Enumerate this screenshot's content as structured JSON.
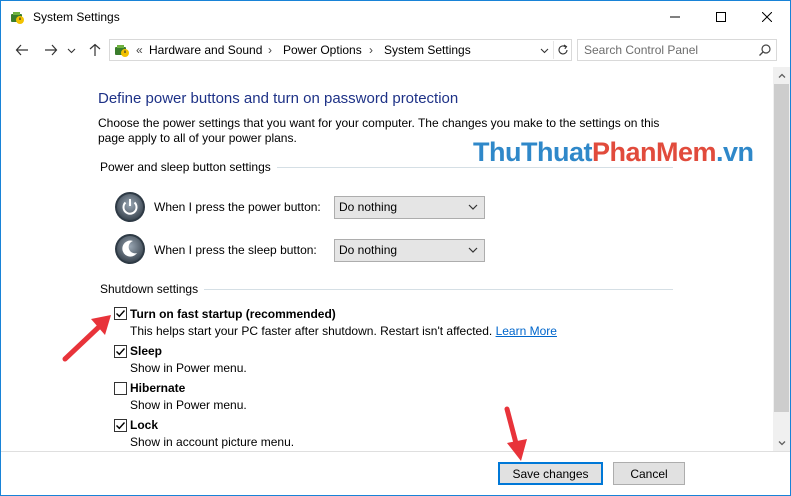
{
  "window": {
    "title": "System Settings"
  },
  "address_bar": {
    "overflow": "«",
    "crumbs": [
      "Hardware and Sound",
      "Power Options",
      "System Settings"
    ],
    "separator": "›"
  },
  "search": {
    "placeholder": "Search Control Panel"
  },
  "page": {
    "heading": "Define power buttons and turn on password protection",
    "description": "Choose the power settings that you want for your computer. The changes you make to the settings on this page apply to all of your power plans."
  },
  "power_sleep": {
    "group_label": "Power and sleep button settings",
    "power_button": {
      "label": "When I press the power button:",
      "value": "Do nothing"
    },
    "sleep_button": {
      "label": "When I press the sleep button:",
      "value": "Do nothing"
    }
  },
  "shutdown": {
    "group_label": "Shutdown settings",
    "items": [
      {
        "label": "Turn on fast startup (recommended)",
        "checked": true,
        "bold": true,
        "desc": "This helps start your PC faster after shutdown. Restart isn't affected.",
        "link": "Learn More"
      },
      {
        "label": "Sleep",
        "checked": true,
        "desc": "Show in Power menu."
      },
      {
        "label": "Hibernate",
        "checked": false,
        "desc": "Show in Power menu."
      },
      {
        "label": "Lock",
        "checked": true,
        "desc": "Show in account picture menu."
      }
    ]
  },
  "footer": {
    "save_label": "Save changes",
    "cancel_label": "Cancel"
  },
  "watermark": {
    "part1": "ThuThuat",
    "part2": "PhanMem",
    "part3": ".vn"
  },
  "colors": {
    "heading": "#1e3287",
    "link": "#0066cc",
    "arrow": "#e8333a",
    "window_border": "#1883d7"
  },
  "icons": {
    "app": "power-options-icon",
    "back": "arrow-left-icon",
    "forward": "arrow-right-icon",
    "recent": "chevron-down-icon",
    "up": "arrow-up-icon",
    "refresh": "refresh-icon",
    "search": "search-icon",
    "power": "power-button-icon",
    "sleep": "sleep-moon-icon"
  }
}
